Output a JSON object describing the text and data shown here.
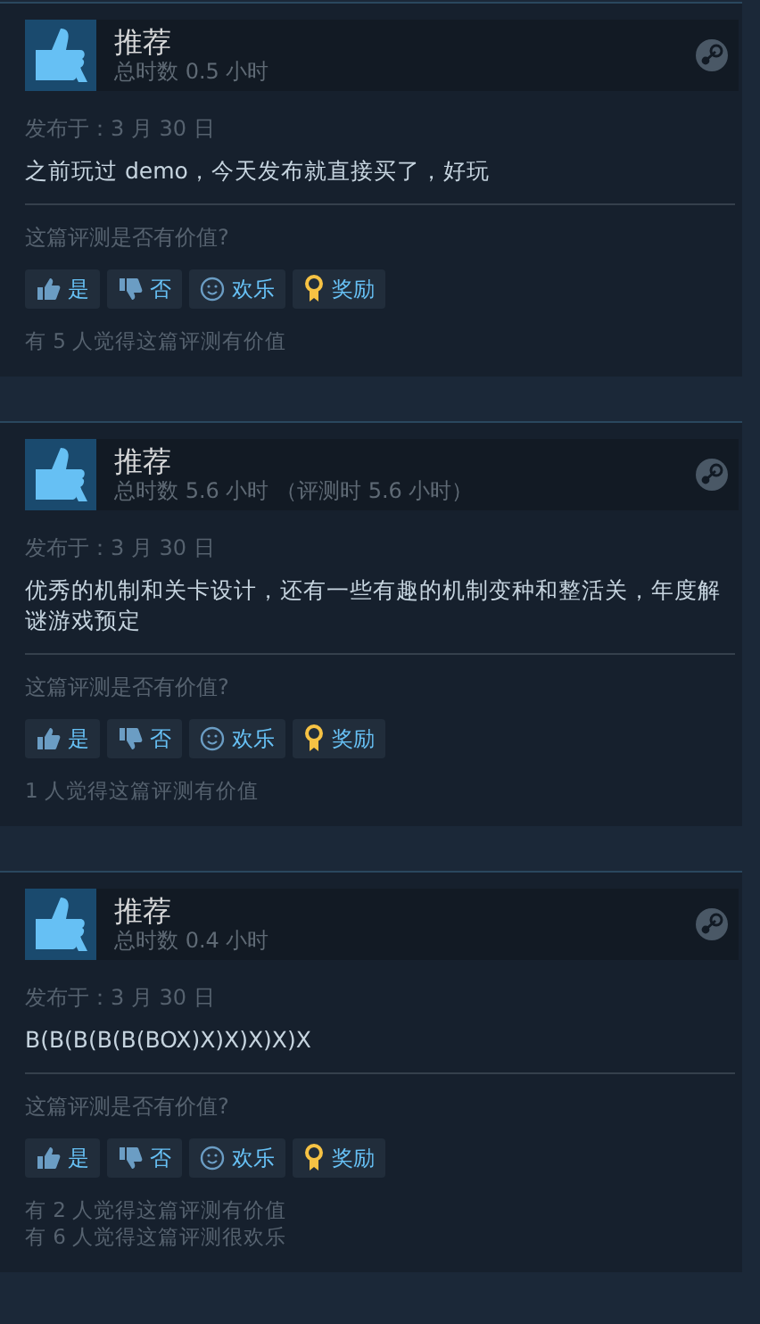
{
  "reviews": [
    {
      "title": "推荐",
      "hours": "总时数 0.5 小时",
      "posted": "发布于：3 月 30 日",
      "body": "之前玩过 demo，今天发布就直接买了，好玩",
      "question": "这篇评测是否有价值?",
      "buttons": [
        {
          "kind": "yes",
          "label": "是"
        },
        {
          "kind": "no",
          "label": "否"
        },
        {
          "kind": "funny",
          "label": "欢乐"
        },
        {
          "kind": "award",
          "label": "奖励"
        }
      ],
      "counts": [
        "有 5 人觉得这篇评测有价值"
      ]
    },
    {
      "title": "推荐",
      "hours": "总时数 5.6 小时 （评测时 5.6 小时）",
      "posted": "发布于：3 月 30 日",
      "body": "优秀的机制和关卡设计，还有一些有趣的机制变种和整活关，年度解谜游戏预定",
      "question": "这篇评测是否有价值?",
      "buttons": [
        {
          "kind": "yes",
          "label": "是"
        },
        {
          "kind": "no",
          "label": "否"
        },
        {
          "kind": "funny",
          "label": "欢乐"
        },
        {
          "kind": "award",
          "label": "奖励"
        }
      ],
      "counts": [
        "1 人觉得这篇评测有价值"
      ]
    },
    {
      "title": "推荐",
      "hours": "总时数 0.4 小时",
      "posted": "发布于：3 月 30 日",
      "body": "B(B(B(B(B(BOX)X)X)X)X)X",
      "question": "这篇评测是否有价值?",
      "buttons": [
        {
          "kind": "yes",
          "label": "是"
        },
        {
          "kind": "no",
          "label": "否"
        },
        {
          "kind": "funny",
          "label": "欢乐"
        },
        {
          "kind": "award",
          "label": "奖励"
        }
      ],
      "counts": [
        "有 2 人觉得这篇评测有价值",
        "有 6 人觉得这篇评测很欢乐"
      ]
    }
  ]
}
